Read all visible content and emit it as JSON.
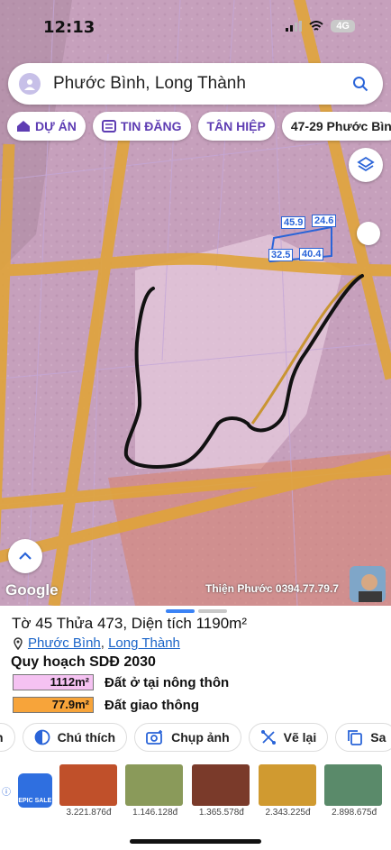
{
  "status": {
    "time": "12:13",
    "network": "4G"
  },
  "search": {
    "text": "Phước Bình, Long Thành"
  },
  "chips": [
    {
      "label": "DỰ ÁN"
    },
    {
      "label": "TIN ĐĂNG"
    },
    {
      "label": "TÂN HIỆP"
    },
    {
      "label": "47-29 Phước Bìn"
    }
  ],
  "map": {
    "measures": [
      "45.9",
      "24.6",
      "32.5",
      "40.4"
    ],
    "google_label": "Google",
    "watermark": "Thiện Phước 0394.77.79.7"
  },
  "parcel": {
    "title": "Tờ 45 Thửa 473, Diện tích 1190m²",
    "location_a": "Phước Bình",
    "location_sep": ",",
    "location_b": "Long Thành",
    "plan_title": "Quy hoạch SDĐ 2030",
    "zones": [
      {
        "area": "1112m²",
        "label": "Đất ở tại nông thôn",
        "color": "#f5c2f2"
      },
      {
        "area": "77.9m²",
        "label": "Đất giao thông",
        "color": "#f7a43a"
      }
    ]
  },
  "actions": [
    {
      "label": "n",
      "icon": "partial-icon"
    },
    {
      "label": "Chú thích",
      "icon": "legend-icon"
    },
    {
      "label": "Chụp ảnh",
      "icon": "camera-add-icon"
    },
    {
      "label": "Vẽ lại",
      "icon": "redraw-icon"
    },
    {
      "label": "Sa",
      "icon": "copy-icon"
    }
  ],
  "ads": {
    "sale_label": "EPIC SALE",
    "products": [
      {
        "price": "3.221.876đ",
        "color": "#c0502a"
      },
      {
        "price": "1.146.128đ",
        "color": "#8a9a5a"
      },
      {
        "price": "1.365.578đ",
        "color": "#7a3a2a"
      },
      {
        "price": "2.343.225đ",
        "color": "#d09a30"
      },
      {
        "price": "2.898.675đ",
        "color": "#5a8a6a"
      }
    ]
  }
}
